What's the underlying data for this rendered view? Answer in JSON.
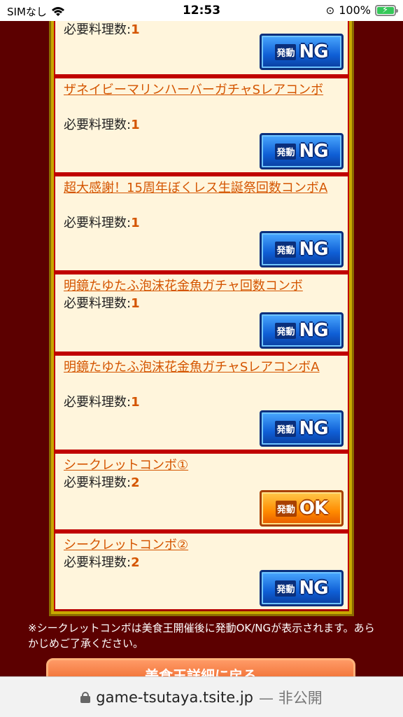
{
  "status_bar": {
    "carrier": "SIMなし",
    "time": "12:53",
    "battery_pct": "100%",
    "wifi_icon": "wifi-icon",
    "battery_icon": "battery-charging-icon"
  },
  "combos": [
    {
      "title": "",
      "requirement_label": "必要料理数:",
      "requirement_count": "1",
      "status": "NG"
    },
    {
      "title": "ザネイビーマリンハーバーガチャSレアコンボ",
      "requirement_label": "必要料理数:",
      "requirement_count": "1",
      "status": "NG"
    },
    {
      "title": "超大感謝！15周年ぼくレス生誕祭回数コンボA",
      "requirement_label": "必要料理数:",
      "requirement_count": "1",
      "status": "NG"
    },
    {
      "title": "明鏡たゆたふ泡沫花金魚ガチャ回数コンボ",
      "requirement_label": "必要料理数:",
      "requirement_count": "1",
      "status": "NG"
    },
    {
      "title": "明鏡たゆたふ泡沫花金魚ガチャSレアコンボA",
      "requirement_label": "必要料理数:",
      "requirement_count": "1",
      "status": "NG"
    },
    {
      "title": "シークレットコンボ①",
      "requirement_label": "必要料理数:",
      "requirement_count": "2",
      "status": "OK"
    },
    {
      "title": "シークレットコンボ②",
      "requirement_label": "必要料理数:",
      "requirement_count": "2",
      "status": "NG"
    }
  ],
  "button_labels": {
    "trigger": "発動",
    "ng": "NG",
    "ok": "OK"
  },
  "note": "※シークレットコンボは美食王開催後に発動OK/NGが表示されます。あらかじめご了承ください。",
  "bottom_button_label": "美食王詳細に戻る",
  "url_bar": {
    "domain": "game-tsutaya.tsite.jp",
    "suffix": "— 非公開"
  },
  "colors": {
    "ng_blue": "#0f5fd6",
    "ok_orange": "#ff8a00",
    "link_orange": "#d45500",
    "frame_red": "#c00000"
  }
}
